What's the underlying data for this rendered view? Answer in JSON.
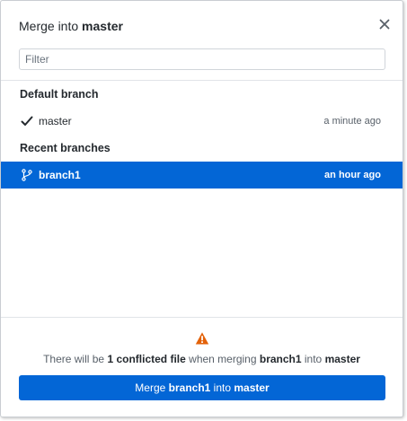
{
  "dialog": {
    "title_prefix": "Merge into",
    "title_branch": "master",
    "close_icon": "close-icon"
  },
  "filter": {
    "placeholder": "Filter",
    "value": ""
  },
  "default_branch": {
    "label": "Default branch",
    "name": "master",
    "time": "a minute ago",
    "icon": "checkmark-icon"
  },
  "recent_branches": {
    "label": "Recent branches",
    "items": [
      {
        "name": "branch1",
        "time": "an hour ago",
        "icon": "git-branch-icon",
        "selected": true
      }
    ]
  },
  "footer": {
    "warning_icon": "warning-icon",
    "message": {
      "part1": "There will be ",
      "conflict": "1 conflicted file",
      "part2": " when merging ",
      "source": "branch1",
      "part3": " into ",
      "target": "master"
    },
    "button": {
      "prefix": "Merge ",
      "source": "branch1",
      "middle": " into ",
      "target": "master"
    }
  },
  "colors": {
    "accent": "#0366d6",
    "warning": "#e36209",
    "text": "#24292e",
    "muted": "#586069"
  }
}
